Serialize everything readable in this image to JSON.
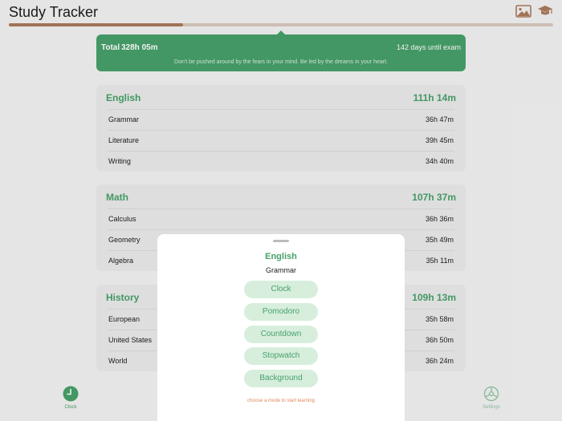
{
  "header": {
    "title": "Study Tracker",
    "icons": [
      "image-icon",
      "graduation-cap-icon"
    ]
  },
  "progress": {
    "fraction": 0.32,
    "fill_color": "#a97a5c",
    "track_color": "#d9c8bd"
  },
  "banner": {
    "total_label": "Total",
    "total_value": "328h 05m",
    "days_until_exam": "142 days until exam",
    "quote": "Don't be pushed around by the fears in your mind. Be led by the dreams in your heart.",
    "color": "#47a06a"
  },
  "subjects": [
    {
      "name": "English",
      "total": "111h 14m",
      "topics": [
        {
          "name": "Grammar",
          "time": "36h 47m"
        },
        {
          "name": "Literature",
          "time": "39h 45m"
        },
        {
          "name": "Writing",
          "time": "34h 40m"
        }
      ]
    },
    {
      "name": "Math",
      "total": "107h 37m",
      "topics": [
        {
          "name": "Calculus",
          "time": "36h 36m"
        },
        {
          "name": "Geometry",
          "time": "35h 49m"
        },
        {
          "name": "Algebra",
          "time": "35h 11m"
        }
      ]
    },
    {
      "name": "History",
      "total": "109h 13m",
      "topics": [
        {
          "name": "European",
          "time": "35h 58m"
        },
        {
          "name": "United States",
          "time": "36h 50m"
        },
        {
          "name": "World",
          "time": "36h 24m"
        }
      ]
    }
  ],
  "tabbar": {
    "clock_label": "Clock",
    "settings_label": "Settings"
  },
  "sheet": {
    "subject": "English",
    "topic": "Grammar",
    "modes": [
      "Clock",
      "Pomodoro",
      "Countdown",
      "Stopwatch",
      "Background"
    ],
    "hint": "choose a mode to start learning"
  }
}
